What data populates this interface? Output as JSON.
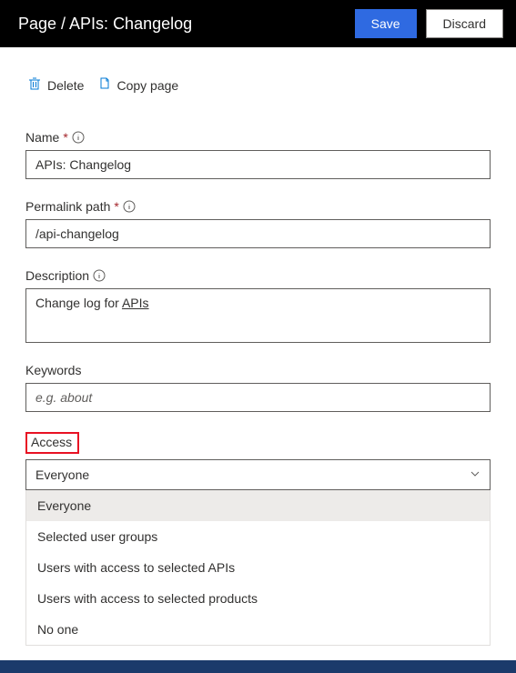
{
  "header": {
    "title": "Page / APIs: Changelog",
    "save": "Save",
    "discard": "Discard"
  },
  "toolbar": {
    "delete": "Delete",
    "copy": "Copy page"
  },
  "fields": {
    "name": {
      "label": "Name",
      "value": "APIs: Changelog"
    },
    "permalink": {
      "label": "Permalink path",
      "value": "/api-changelog"
    },
    "description": {
      "label": "Description",
      "prefix": "Change log for ",
      "underlined": "APIs"
    },
    "keywords": {
      "label": "Keywords",
      "placeholder": "e.g. about"
    },
    "access": {
      "label": "Access",
      "selected": "Everyone",
      "options": [
        "Everyone",
        "Selected user groups",
        "Users with access to selected APIs",
        "Users with access to selected products",
        "No one"
      ]
    }
  }
}
